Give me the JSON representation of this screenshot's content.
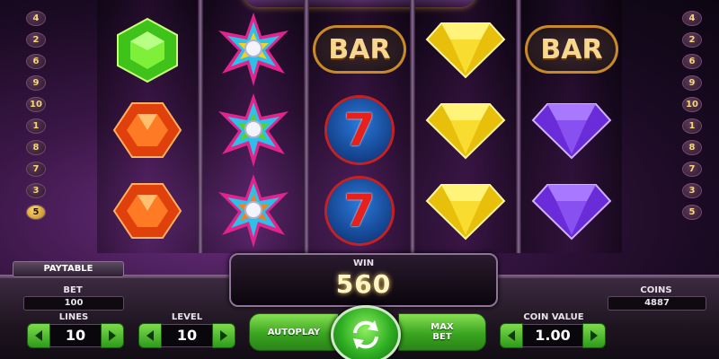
{
  "left_paylines": [
    "4",
    "2",
    "6",
    "9",
    "10",
    "1",
    "8",
    "7",
    "3",
    "5"
  ],
  "right_paylines": [
    "4",
    "2",
    "6",
    "9",
    "10",
    "1",
    "8",
    "7",
    "3",
    "5"
  ],
  "reels": [
    [
      "green-gem",
      "orange-gem",
      "orange-gem"
    ],
    [
      "starburst-wild",
      "starburst-wild",
      "starburst-wild"
    ],
    [
      "bar",
      "seven",
      "seven"
    ],
    [
      "yellow-gem",
      "yellow-gem",
      "yellow-gem"
    ],
    [
      "bar",
      "purple-gem",
      "purple-gem"
    ]
  ],
  "bar_label": "BAR",
  "seven_label": "7",
  "paytable_label": "PAYTABLE",
  "win": {
    "label": "WIN",
    "value": "560"
  },
  "bet": {
    "label": "BET",
    "value": "100"
  },
  "lines": {
    "label": "LINES",
    "value": "10"
  },
  "level": {
    "label": "LEVEL",
    "value": "10"
  },
  "autoplay_label": "AUTOPLAY",
  "max_bet_label_1": "MAX",
  "max_bet_label_2": "BET",
  "coins": {
    "label": "COINS",
    "value": "4887"
  },
  "coin_value": {
    "label": "COIN VALUE",
    "value": "1.00"
  },
  "colors": {
    "accent_green": "#3aa420",
    "gold": "#ffd860",
    "background": "#3a1646"
  }
}
